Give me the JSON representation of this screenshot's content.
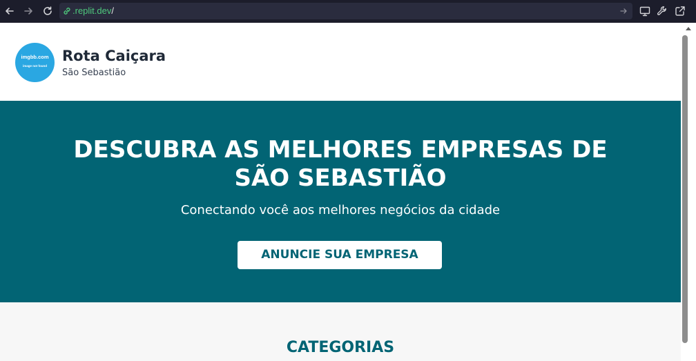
{
  "browser": {
    "url_prefix": ".replit.dev",
    "url_suffix": "/"
  },
  "header": {
    "logo_line1": "imgbb.com",
    "logo_line2": "image not found",
    "brand_name": "Rota Caiçara",
    "city": "São Sebastião"
  },
  "hero": {
    "title": "DESCUBRA AS MELHORES EMPRESAS DE SÃO SEBASTIÃO",
    "subtitle": "Conectando você aos melhores negócios da cidade",
    "cta_label": "ANUNCIE SUA EMPRESA"
  },
  "categories": {
    "title": "CATEGORIAS"
  },
  "colors": {
    "primary": "#026474",
    "logo_bg": "#2aa7e2",
    "toolbar_bg": "#1c1d2b",
    "url_green": "#4fc97d"
  },
  "icons": [
    "back-arrow-icon",
    "forward-arrow-icon",
    "reload-icon",
    "link-icon",
    "go-arrow-icon",
    "monitor-icon",
    "wrench-icon",
    "external-link-icon"
  ]
}
